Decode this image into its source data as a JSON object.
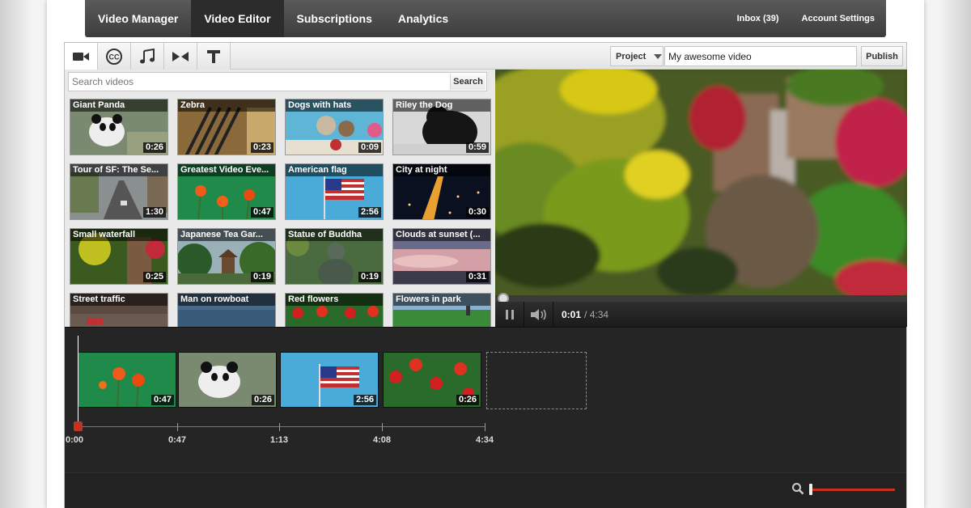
{
  "nav": {
    "tabs": [
      "Video Manager",
      "Video Editor",
      "Subscriptions",
      "Analytics"
    ],
    "active_tab": "Video Editor",
    "inbox": "Inbox (39)",
    "account": "Account Settings"
  },
  "toolbar": {
    "tools": [
      "video-camera-icon",
      "closed-caption-icon",
      "music-note-icon",
      "transition-icon",
      "text-icon"
    ],
    "project_label": "Project",
    "project_title": "My awesome video",
    "publish_label": "Publish"
  },
  "library": {
    "search_placeholder": "Search videos",
    "search_button": "Search",
    "videos": [
      {
        "title": "Giant Panda",
        "duration": "0:26"
      },
      {
        "title": "Zebra",
        "duration": "0:23"
      },
      {
        "title": "Dogs with hats",
        "duration": "0:09"
      },
      {
        "title": "Riley the Dog",
        "duration": "0:59"
      },
      {
        "title": "Tour of SF: The Se...",
        "duration": "1:30"
      },
      {
        "title": "Greatest Video Eve...",
        "duration": "0:47"
      },
      {
        "title": "American flag",
        "duration": "2:56"
      },
      {
        "title": "City at night",
        "duration": "0:30"
      },
      {
        "title": "Small waterfall",
        "duration": "0:25"
      },
      {
        "title": "Japanese Tea Gar...",
        "duration": "0:19"
      },
      {
        "title": "Statue of Buddha",
        "duration": "0:19"
      },
      {
        "title": "Clouds at sunset (...",
        "duration": "0:31"
      },
      {
        "title": "Street traffic",
        "duration": ""
      },
      {
        "title": "Man on rowboat",
        "duration": ""
      },
      {
        "title": "Red flowers",
        "duration": ""
      },
      {
        "title": "Flowers in park",
        "duration": ""
      }
    ]
  },
  "player": {
    "current_time": "0:01",
    "total_time": "/ 4:34",
    "progress": 0.004
  },
  "timeline": {
    "clips": [
      {
        "duration": "0:47"
      },
      {
        "duration": "0:26"
      },
      {
        "duration": "2:56"
      },
      {
        "duration": "0:26"
      }
    ],
    "ticks": [
      "0:00",
      "0:47",
      "1:13",
      "4:08",
      "4:34"
    ]
  },
  "colors": {
    "accent": "#c8321d",
    "nav_bg": "#3d3d3d",
    "timeline_bg": "#252525"
  }
}
